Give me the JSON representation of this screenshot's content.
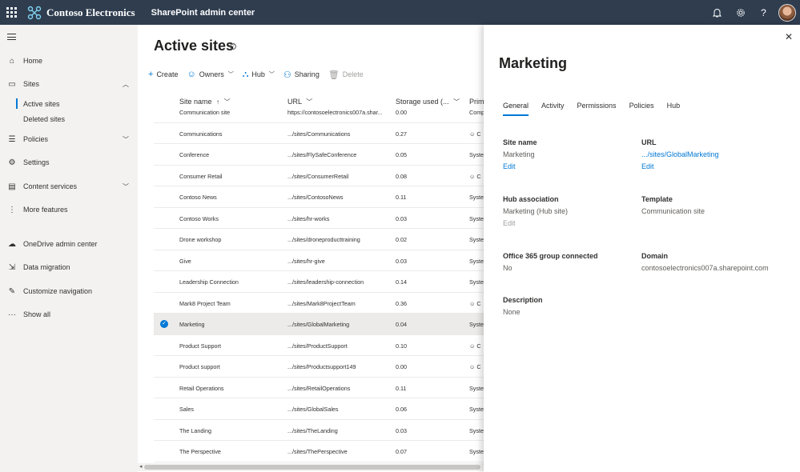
{
  "topbar": {
    "org": "Contoso Electronics",
    "app": "SharePoint admin center",
    "icons": [
      "bell-icon",
      "gear-icon",
      "help-icon"
    ],
    "bg": "#2f3d4f"
  },
  "nav": {
    "items": [
      {
        "label": "Home",
        "icon": "home-icon"
      },
      {
        "label": "Sites",
        "icon": "sites-icon"
      },
      {
        "label": "Policies",
        "icon": "policies-icon"
      },
      {
        "label": "Settings",
        "icon": "gear-icon"
      },
      {
        "label": "Content services",
        "icon": "content-icon"
      },
      {
        "label": "More features",
        "icon": "more-icon"
      },
      {
        "label": "OneDrive admin center",
        "icon": "cloud-icon"
      },
      {
        "label": "Data migration",
        "icon": "migration-icon"
      },
      {
        "label": "Customize navigation",
        "icon": "pencil-icon"
      },
      {
        "label": "Show all",
        "icon": "ellipsis-icon"
      }
    ],
    "sites_sub": [
      "Active sites",
      "Deleted sites"
    ]
  },
  "main": {
    "title": "Active sites",
    "commands": {
      "create": "Create",
      "owners": "Owners",
      "hub": "Hub",
      "sharing": "Sharing",
      "delete": "Delete"
    },
    "columns": {
      "name": "Site name",
      "name_sort": "↑",
      "url": "URL",
      "storage": "Storage used (...",
      "primary": "Prim"
    },
    "rows": [
      {
        "name": "Communication site",
        "url": "https://contosoelectronics007a.shar...",
        "storage": "0.00",
        "prim": "Comp"
      },
      {
        "name": "Communications",
        "url": ".../sites/Communications",
        "storage": "0.27",
        "prim": "☺ C"
      },
      {
        "name": "Conference",
        "url": ".../sites/FlySafeConference",
        "storage": "0.05",
        "prim": "Syste"
      },
      {
        "name": "Consumer Retail",
        "url": ".../sites/ConsumerRetail",
        "storage": "0.08",
        "prim": "☺ C"
      },
      {
        "name": "Contoso News",
        "url": ".../sites/ContosoNews",
        "storage": "0.11",
        "prim": "Syste"
      },
      {
        "name": "Contoso Works",
        "url": ".../sites/hr-works",
        "storage": "0.03",
        "prim": "Syste"
      },
      {
        "name": "Drone workshop",
        "url": ".../sites/droneproducttraining",
        "storage": "0.02",
        "prim": "Syste"
      },
      {
        "name": "Give",
        "url": ".../sites/hr-give",
        "storage": "0.03",
        "prim": "Syste"
      },
      {
        "name": "Leadership Connection",
        "url": ".../sites/leadership-connection",
        "storage": "0.14",
        "prim": "Syste"
      },
      {
        "name": "Mark8 Project Team",
        "url": ".../sites/Mark8ProjectTeam",
        "storage": "0.36",
        "prim": "☺ C"
      },
      {
        "name": "Marketing",
        "url": ".../sites/GlobalMarketing",
        "storage": "0.04",
        "prim": "Syste"
      },
      {
        "name": "Product Support",
        "url": ".../sites/ProductSupport",
        "storage": "0.10",
        "prim": "☺ C"
      },
      {
        "name": "Product support",
        "url": ".../sites/Productsupport149",
        "storage": "0.00",
        "prim": "☺ C"
      },
      {
        "name": "Retail Operations",
        "url": ".../sites/RetailOperations",
        "storage": "0.11",
        "prim": "Syste"
      },
      {
        "name": "Sales",
        "url": ".../sites/GlobalSales",
        "storage": "0.06",
        "prim": "Syste"
      },
      {
        "name": "The Landing",
        "url": ".../sites/TheLanding",
        "storage": "0.03",
        "prim": "Syste"
      },
      {
        "name": "The Perspective",
        "url": ".../sites/ThePerspective",
        "storage": "0.07",
        "prim": "Syste"
      }
    ],
    "selected_row": "Marketing"
  },
  "panel": {
    "title": "Marketing",
    "tabs": [
      "General",
      "Activity",
      "Permissions",
      "Policies",
      "Hub"
    ],
    "active_tab": "General",
    "site_name": {
      "label": "Site name",
      "value": "Marketing",
      "edit": "Edit"
    },
    "url": {
      "label": "URL",
      "value": ".../sites/GlobalMarketing",
      "edit": "Edit"
    },
    "hub": {
      "label": "Hub association",
      "value": "Marketing (Hub site)",
      "edit": "Edit"
    },
    "template": {
      "label": "Template",
      "value": "Communication site"
    },
    "group": {
      "label": "Office 365 group connected",
      "value": "No"
    },
    "domain": {
      "label": "Domain",
      "value": "contosoelectronics007a.sharepoint.com"
    },
    "description": {
      "label": "Description",
      "value": "None"
    }
  },
  "colors": {
    "accent": "#0078d4",
    "nav_bg": "#f3f2f1",
    "selected_row": "#edebe9"
  }
}
